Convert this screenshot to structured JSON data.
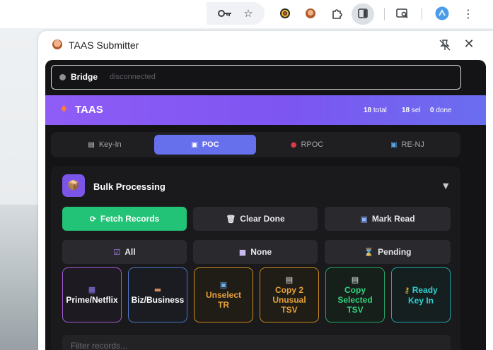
{
  "panel": {
    "title": "TAAS Submitter"
  },
  "bridge": {
    "label": "Bridge",
    "status": "disconnected"
  },
  "header": {
    "title": "TAAS",
    "stats": [
      {
        "value": "18",
        "label": "total"
      },
      {
        "value": "18",
        "label": "sel"
      },
      {
        "value": "0",
        "label": "done"
      }
    ]
  },
  "tabs": [
    {
      "label": "Key-In",
      "icon": "clipboard-icon"
    },
    {
      "label": "POC",
      "icon": "id-card-icon",
      "active": true
    },
    {
      "label": "RPOC",
      "icon": "red-circle-icon"
    },
    {
      "label": "RE-NJ",
      "icon": "card-icon"
    }
  ],
  "bulk": {
    "title": "Bulk Processing",
    "actions": {
      "fetch": "Fetch Records",
      "clear": "Clear Done",
      "mark": "Mark Read"
    },
    "select": {
      "all": "All",
      "none": "None",
      "pending": "Pending"
    },
    "tiles": {
      "prime": "Prime/Netflix",
      "biz": "Biz/Business",
      "unselect": "Unselect TR",
      "copy_unusual": "Copy 2 Unusual TSV",
      "copy_selected": "Copy Selected TSV",
      "ready": "Ready Key In"
    },
    "filter_placeholder": "Filter records..."
  },
  "colors": {
    "accent": "#6770ec",
    "banner_start": "#8f5cf6",
    "banner_end": "#6a6ef0",
    "fetch_green": "#22c376",
    "tile_purple": "#a35ad6",
    "tile_blue": "#4b77c6",
    "tile_orange": "#c98a1f",
    "tile_green": "#22a866",
    "tile_teal": "#1fa7a8"
  }
}
